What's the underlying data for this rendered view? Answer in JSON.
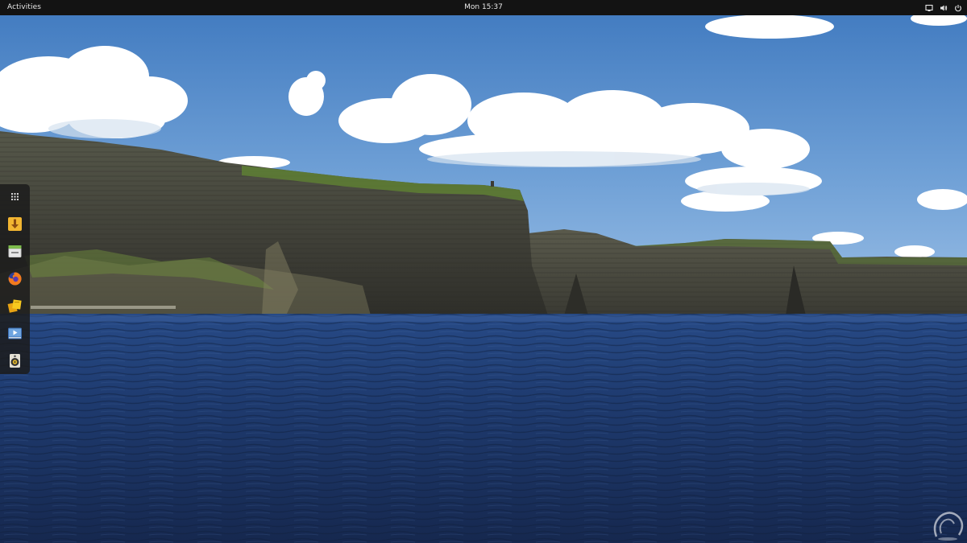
{
  "topbar": {
    "activities_label": "Activities",
    "clock": "Mon 15:37",
    "tray_icons": [
      "screen-icon",
      "volume-icon",
      "power-icon"
    ]
  },
  "dock": {
    "items": [
      {
        "name": "show-apps",
        "icon": "app-grid-icon"
      },
      {
        "name": "downloader",
        "icon": "download-icon"
      },
      {
        "name": "files",
        "icon": "file-manager-icon"
      },
      {
        "name": "firefox",
        "icon": "firefox-icon"
      },
      {
        "name": "office",
        "icon": "office-icon"
      },
      {
        "name": "video-player",
        "icon": "video-player-icon"
      },
      {
        "name": "speaker",
        "icon": "speaker-icon"
      }
    ]
  },
  "colors": {
    "topbar_bg": "#131313",
    "sky": "#4a86c8",
    "sea": "#1c3566",
    "cliff": "#4a4a42",
    "grass": "#6b8a3a"
  }
}
